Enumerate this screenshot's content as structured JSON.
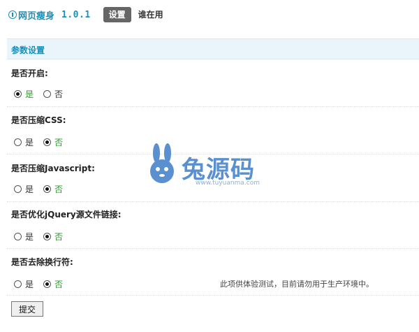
{
  "header": {
    "app_name": "网页瘦身",
    "version": "1.0.1",
    "tabs": [
      {
        "label": "设置",
        "active": true
      },
      {
        "label": "谁在用",
        "active": false
      }
    ]
  },
  "section": {
    "title": "参数设置"
  },
  "settings": [
    {
      "label": "是否开启:",
      "options": [
        {
          "label": "是",
          "checked": true
        },
        {
          "label": "否",
          "checked": false
        }
      ]
    },
    {
      "label": "是否压缩CSS:",
      "options": [
        {
          "label": "是",
          "checked": false
        },
        {
          "label": "否",
          "checked": true
        }
      ]
    },
    {
      "label": "是否压缩Javascript:",
      "options": [
        {
          "label": "是",
          "checked": false
        },
        {
          "label": "否",
          "checked": true
        }
      ]
    },
    {
      "label": "是否优化jQuery源文件链接:",
      "options": [
        {
          "label": "是",
          "checked": false
        },
        {
          "label": "否",
          "checked": true
        }
      ]
    },
    {
      "label": "是否去除换行符:",
      "options": [
        {
          "label": "是",
          "checked": false
        },
        {
          "label": "否",
          "checked": true
        }
      ]
    }
  ],
  "note": "此项供体验测试，目前请勿用于生产环境中。",
  "submit_label": "提交",
  "watermark": {
    "text": "兔源码",
    "url": "www.tuyuanma.com"
  },
  "colors": {
    "accent": "#1a8fb8",
    "selected_option": "#2a9a2a",
    "section_bg": "#eaf4fb",
    "active_tab_bg": "#666666"
  }
}
